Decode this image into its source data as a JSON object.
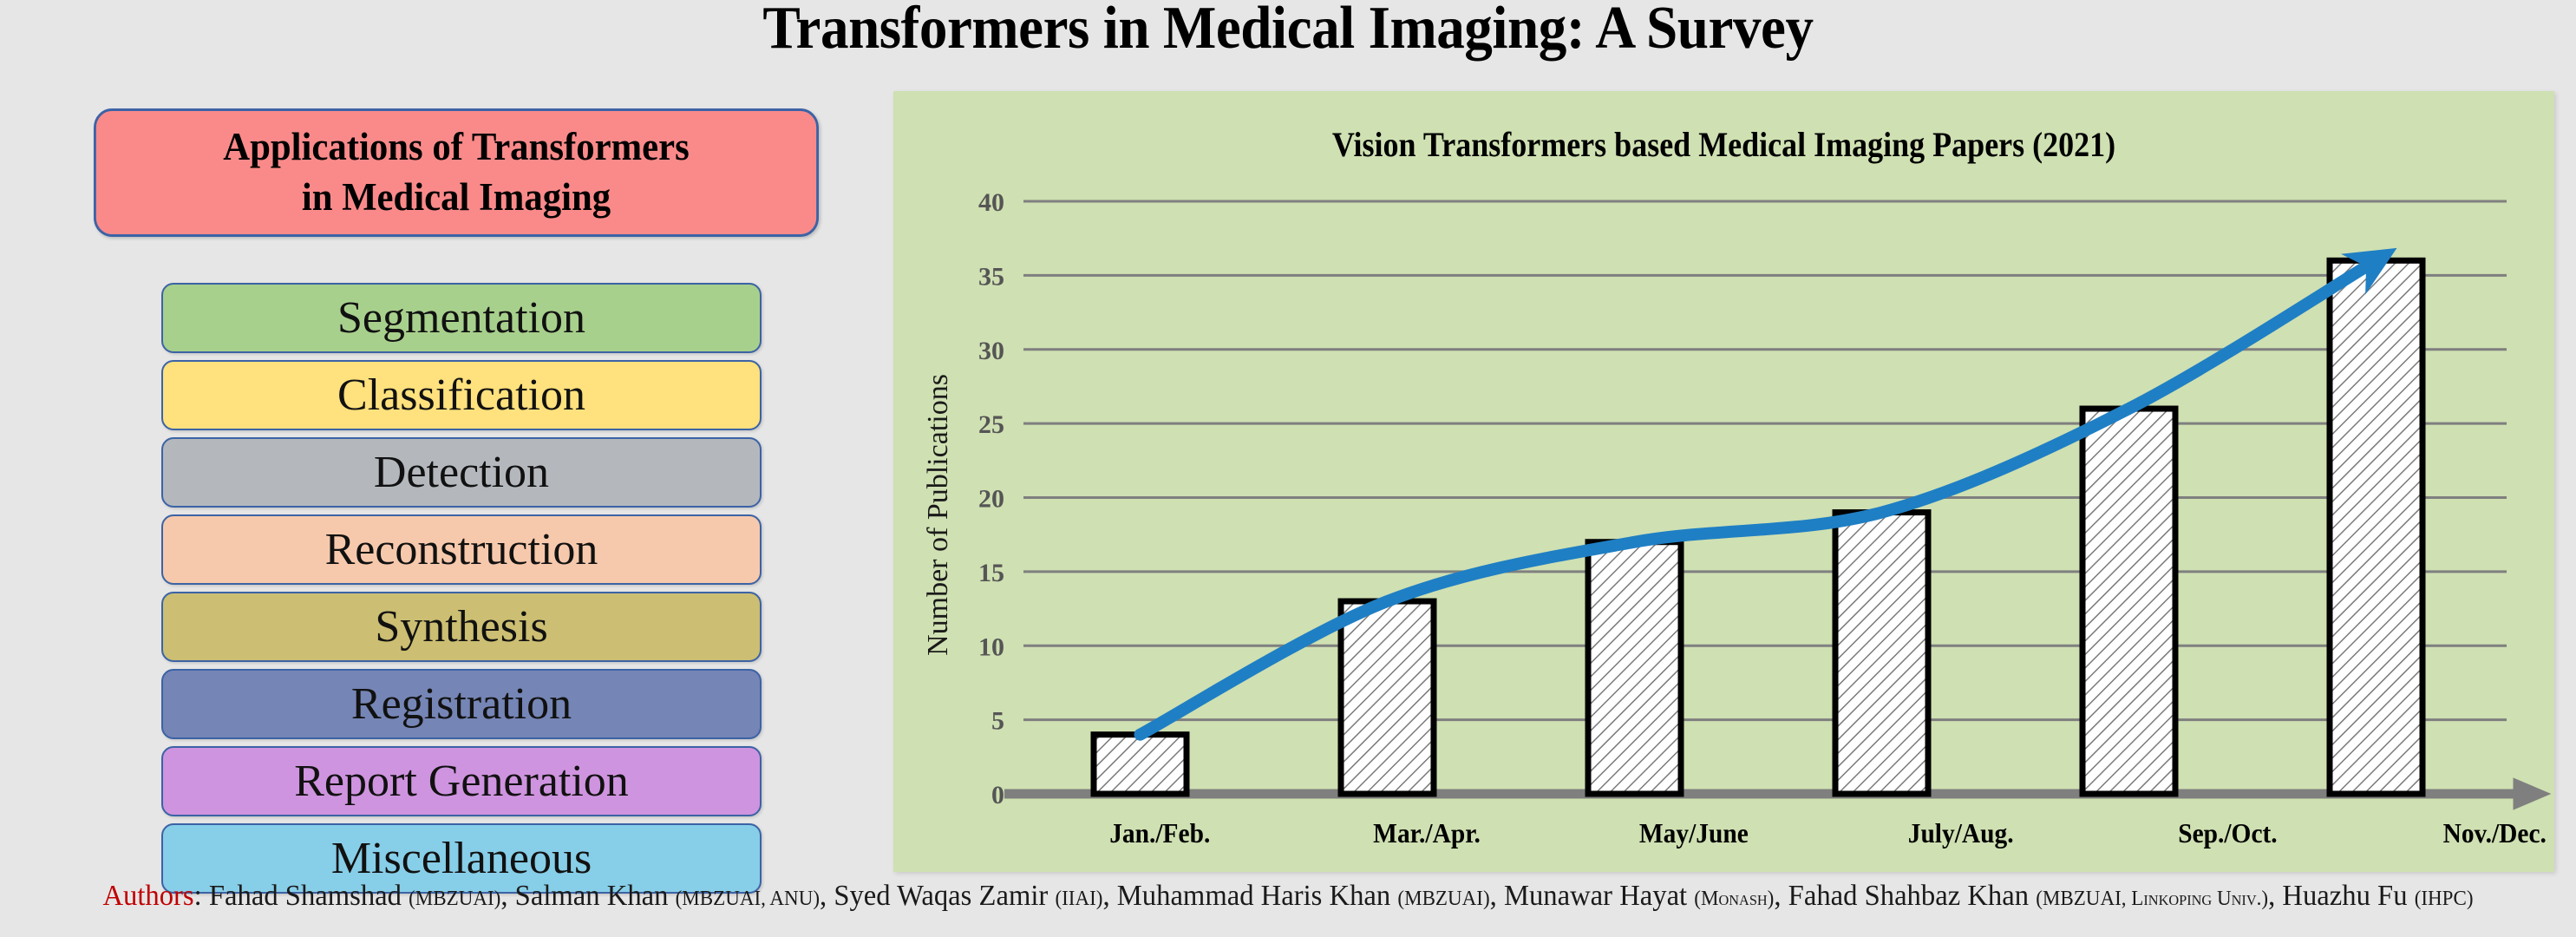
{
  "page": {
    "title": "Transformers in Medical Imaging: A Survey",
    "background_color": "#e6e6e6"
  },
  "left_panel": {
    "header": {
      "line1": "Applications of Transformers",
      "line2": "in Medical Imaging",
      "fill_color": "#fa8a8a",
      "border_color": "#3c63a5"
    },
    "categories": [
      {
        "label": "Segmentation",
        "color": "#a8d08d"
      },
      {
        "label": "Classification",
        "color": "#ffe17d"
      },
      {
        "label": "Detection",
        "color": "#b4b8bd"
      },
      {
        "label": "Reconstruction",
        "color": "#f7c9ac"
      },
      {
        "label": "Synthesis",
        "color": "#ccbe72"
      },
      {
        "label": "Registration",
        "color": "#7585b5"
      },
      {
        "label": "Report Generation",
        "color": "#cf94df"
      },
      {
        "label": "Miscellaneous",
        "color": "#87cee8"
      }
    ]
  },
  "chart_panel": {
    "background_color": "#cfe0b2",
    "trend_color": "#1f7fc4"
  },
  "chart_data": {
    "type": "bar",
    "title": "Vision Transformers based Medical Imaging Papers (2021)",
    "xlabel": "",
    "ylabel": "Number of Publications",
    "categories": [
      "Jan./Feb.",
      "Mar./Apr.",
      "May/June",
      "July/Aug.",
      "Sep./Oct.",
      "Nov./Dec."
    ],
    "values": [
      4,
      13,
      17,
      19,
      26,
      36
    ],
    "ylim": [
      0,
      40
    ],
    "yticks": [
      0,
      5,
      10,
      15,
      20,
      25,
      30,
      35,
      40
    ],
    "grid": true,
    "legend": "none",
    "bar_style": {
      "fill": "white",
      "hatch": "diagonal",
      "edge_color": "#000000"
    },
    "annotations": [
      {
        "type": "trend-arrow",
        "color": "#1f7fc4",
        "description": "Upward curved arrow tracing the growth of publications from Jan./Feb. to Nov./Dec."
      }
    ]
  },
  "authors": {
    "label": "Authors",
    "separator": ": ",
    "list": [
      {
        "name": "Fahad Shamshad",
        "affiliation": "MBZUAI"
      },
      {
        "name": "Salman Khan",
        "affiliation": "MBZUAI, ANU"
      },
      {
        "name": "Syed Waqas Zamir",
        "affiliation": "IIAI"
      },
      {
        "name": "Muhammad Haris Khan",
        "affiliation": "MBZUAI"
      },
      {
        "name": "Munawar Hayat",
        "affiliation": "Monash"
      },
      {
        "name": "Fahad Shahbaz Khan",
        "affiliation": "MBZUAI, Linkoping Univ."
      },
      {
        "name": "Huazhu Fu",
        "affiliation": "IHPC"
      }
    ]
  }
}
